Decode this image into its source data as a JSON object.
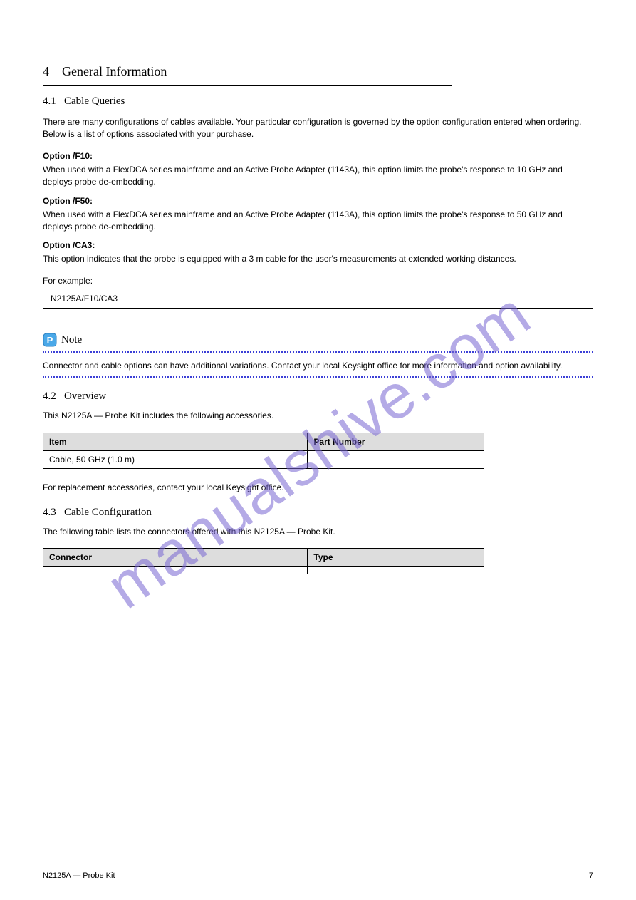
{
  "section": {
    "number": "4",
    "title": "General Information"
  },
  "subsection": {
    "number": "4.1",
    "title": "Cable Queries"
  },
  "intro": "There are many configurations of cables available. Your particular configuration is governed by the option configuration entered when ordering. Below is a list of options associated with your purchase.",
  "options": [
    {
      "name": "Option /F10:",
      "text": "When used with a FlexDCA series mainframe and an Active Probe Adapter (1143A), this option limits the probe's response to 10 GHz and deploys probe de-embedding."
    },
    {
      "name": "Option /F50:",
      "text": "When used with a FlexDCA series mainframe and an Active Probe Adapter (1143A), this option limits the probe's response to 50 GHz and deploys probe de-embedding."
    },
    {
      "name": "Option /CA3:",
      "text": "This option indicates that the probe is equipped with a 3 m cable for the user's measurements at extended working distances."
    }
  ],
  "example": {
    "label": "For example:",
    "content": "N2125A/F10/CA3"
  },
  "note": {
    "label": "Note",
    "body": "Connector and cable options can have additional variations. Contact your local Keysight office for more information and option availability."
  },
  "overview": {
    "number": "4.2",
    "title": "Overview",
    "text": "This N2125A — Probe Kit includes the following accessories."
  },
  "table1": {
    "headers": [
      "Item",
      "Part Number"
    ],
    "rows": [
      [
        "Cable, 50 GHz (1.0 m)",
        ""
      ]
    ],
    "note": "For replacement accessories, contact your local Keysight office."
  },
  "section43": {
    "number": "4.3",
    "title": "Cable Configuration",
    "text": "The following table lists the connectors offered with this N2125A — Probe Kit."
  },
  "table2": {
    "headers": [
      "Connector",
      "Type"
    ],
    "rows": [
      [
        "",
        ""
      ]
    ]
  },
  "footer": {
    "left": "N2125A — Probe Kit",
    "right": "7"
  },
  "watermark": "manualshive.com"
}
